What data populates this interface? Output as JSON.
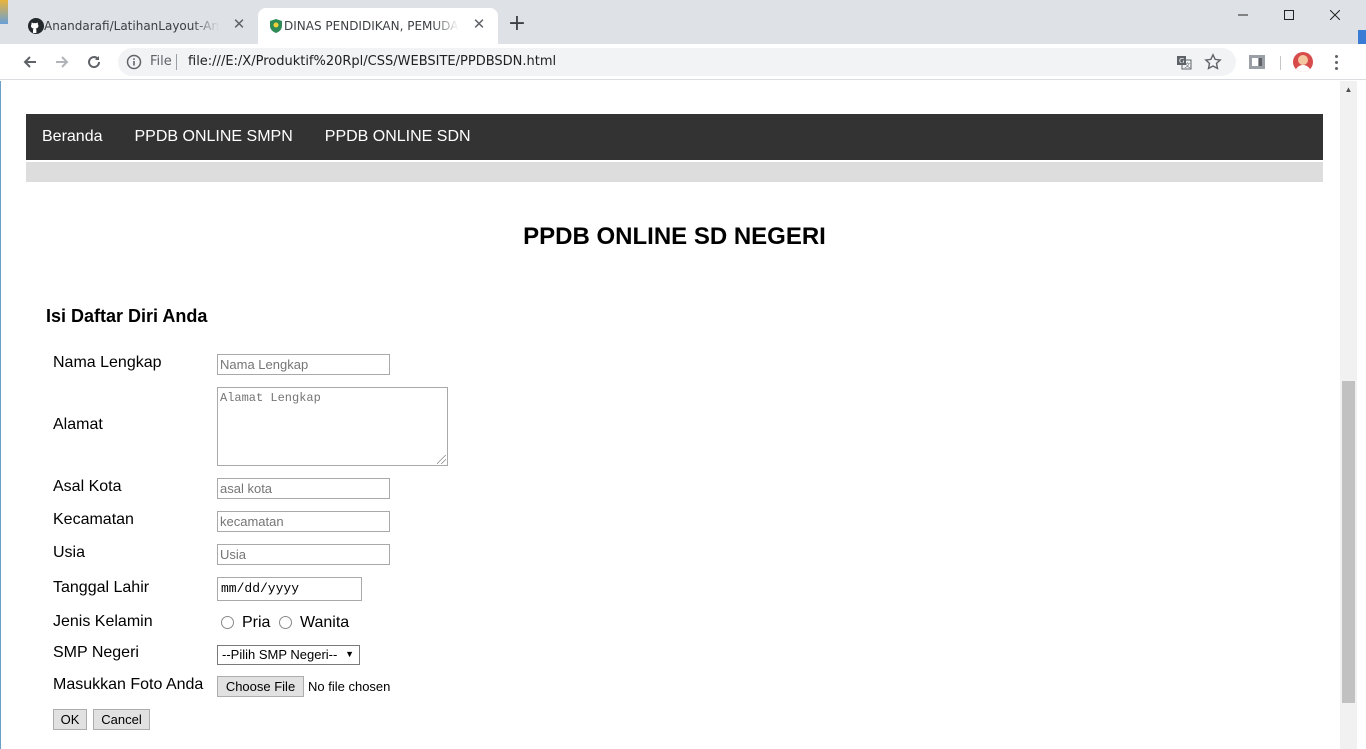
{
  "browser": {
    "tabs": [
      {
        "title": "Anandarafi/LatihanLayout-Anand",
        "active": false
      },
      {
        "title": "DINAS PENDIDIKAN, PEMUDA DAN",
        "active": true
      }
    ],
    "url_scheme": "File",
    "url": "file:///E:/X/Produktif%20Rpl/CSS/WEBSITE/PPDBSDN.html"
  },
  "nav": {
    "items": [
      "Beranda",
      "PPDB ONLINE SMPN",
      "PPDB ONLINE SDN"
    ]
  },
  "page": {
    "title": "PPDB ONLINE SD NEGERI",
    "section_title": "Isi Daftar Diri Anda"
  },
  "form": {
    "nama_label": "Nama Lengkap",
    "nama_placeholder": "Nama Lengkap",
    "alamat_label": "Alamat",
    "alamat_placeholder": "Alamat Lengkap",
    "kota_label": "Asal Kota",
    "kota_placeholder": "asal kota",
    "kecamatan_label": "Kecamatan",
    "kecamatan_placeholder": "kecamatan",
    "usia_label": "Usia",
    "usia_placeholder": "Usia",
    "tanggal_label": "Tanggal Lahir",
    "tanggal_value": "mm/dd/yyyy",
    "kelamin_label": "Jenis Kelamin",
    "kelamin_options": [
      "Pria",
      "Wanita"
    ],
    "smp_label": "SMP Negeri",
    "smp_selected": "--Pilih SMP Negeri--",
    "foto_label": "Masukkan Foto Anda",
    "foto_button": "Choose File",
    "foto_status": "No file chosen",
    "ok_label": "OK",
    "cancel_label": "Cancel"
  },
  "colors": {
    "navbar_bg": "#333333",
    "subbar_bg": "#dddddd",
    "tabstrip_bg": "#dee1e6"
  }
}
